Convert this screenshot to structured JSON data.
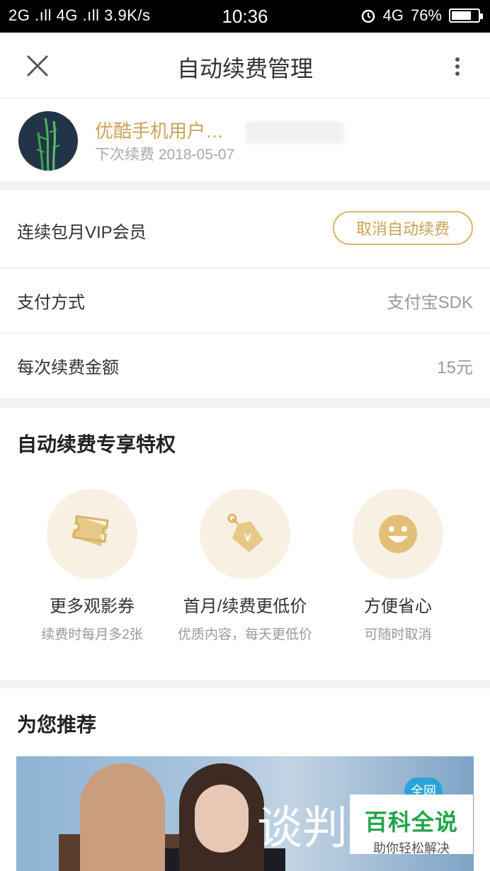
{
  "status_bar": {
    "left": "2G .ıll 4G .ıll 3.9K/s",
    "time": "10:36",
    "network": "4G",
    "battery": "76%",
    "battery_level": 0.76
  },
  "header": {
    "title": "自动续费管理"
  },
  "user": {
    "name": "优酷手机用户…",
    "next_renewal": "下次续费 2018-05-07"
  },
  "subscription": {
    "plan": "连续包月VIP会员",
    "cancel_label": "取消自动续费",
    "payment_label": "支付方式",
    "payment_value": "支付宝SDK",
    "amount_label": "每次续费金额",
    "amount_value": "15元"
  },
  "benefits": {
    "title": "自动续费专享特权",
    "items": [
      {
        "title": "更多观影券",
        "desc": "续费时每月多2张",
        "icon": "ticket-icon"
      },
      {
        "title": "首月/续费更低价",
        "desc": "优质内容，每天更低价",
        "icon": "price-tag-icon"
      },
      {
        "title": "方便省心",
        "desc": "可随时取消",
        "icon": "smile-icon"
      }
    ]
  },
  "recommend": {
    "title": "为您推荐",
    "banner_title": "谈判",
    "banner_badge": "全网"
  },
  "watermark": {
    "brand": "百科全说",
    "slogan": "助你轻松解决"
  },
  "colors": {
    "gold": "#c9a356",
    "icon_bg": "#f8f1e3",
    "icon_fg": "#e2c17c"
  }
}
